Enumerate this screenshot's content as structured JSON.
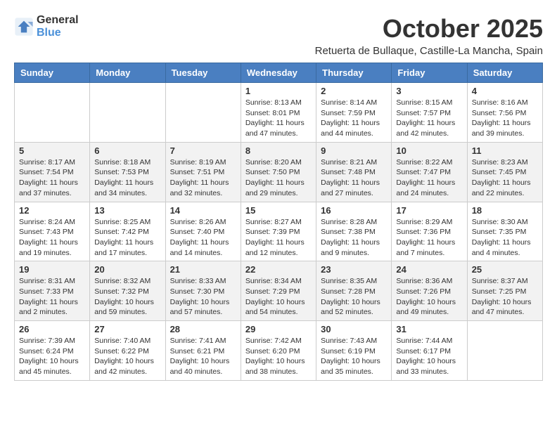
{
  "logo": {
    "general": "General",
    "blue": "Blue"
  },
  "title": "October 2025",
  "location": "Retuerta de Bullaque, Castille-La Mancha, Spain",
  "weekdays": [
    "Sunday",
    "Monday",
    "Tuesday",
    "Wednesday",
    "Thursday",
    "Friday",
    "Saturday"
  ],
  "weeks": [
    [
      {
        "day": "",
        "text": ""
      },
      {
        "day": "",
        "text": ""
      },
      {
        "day": "",
        "text": ""
      },
      {
        "day": "1",
        "text": "Sunrise: 8:13 AM\nSunset: 8:01 PM\nDaylight: 11 hours and 47 minutes."
      },
      {
        "day": "2",
        "text": "Sunrise: 8:14 AM\nSunset: 7:59 PM\nDaylight: 11 hours and 44 minutes."
      },
      {
        "day": "3",
        "text": "Sunrise: 8:15 AM\nSunset: 7:57 PM\nDaylight: 11 hours and 42 minutes."
      },
      {
        "day": "4",
        "text": "Sunrise: 8:16 AM\nSunset: 7:56 PM\nDaylight: 11 hours and 39 minutes."
      }
    ],
    [
      {
        "day": "5",
        "text": "Sunrise: 8:17 AM\nSunset: 7:54 PM\nDaylight: 11 hours and 37 minutes."
      },
      {
        "day": "6",
        "text": "Sunrise: 8:18 AM\nSunset: 7:53 PM\nDaylight: 11 hours and 34 minutes."
      },
      {
        "day": "7",
        "text": "Sunrise: 8:19 AM\nSunset: 7:51 PM\nDaylight: 11 hours and 32 minutes."
      },
      {
        "day": "8",
        "text": "Sunrise: 8:20 AM\nSunset: 7:50 PM\nDaylight: 11 hours and 29 minutes."
      },
      {
        "day": "9",
        "text": "Sunrise: 8:21 AM\nSunset: 7:48 PM\nDaylight: 11 hours and 27 minutes."
      },
      {
        "day": "10",
        "text": "Sunrise: 8:22 AM\nSunset: 7:47 PM\nDaylight: 11 hours and 24 minutes."
      },
      {
        "day": "11",
        "text": "Sunrise: 8:23 AM\nSunset: 7:45 PM\nDaylight: 11 hours and 22 minutes."
      }
    ],
    [
      {
        "day": "12",
        "text": "Sunrise: 8:24 AM\nSunset: 7:43 PM\nDaylight: 11 hours and 19 minutes."
      },
      {
        "day": "13",
        "text": "Sunrise: 8:25 AM\nSunset: 7:42 PM\nDaylight: 11 hours and 17 minutes."
      },
      {
        "day": "14",
        "text": "Sunrise: 8:26 AM\nSunset: 7:40 PM\nDaylight: 11 hours and 14 minutes."
      },
      {
        "day": "15",
        "text": "Sunrise: 8:27 AM\nSunset: 7:39 PM\nDaylight: 11 hours and 12 minutes."
      },
      {
        "day": "16",
        "text": "Sunrise: 8:28 AM\nSunset: 7:38 PM\nDaylight: 11 hours and 9 minutes."
      },
      {
        "day": "17",
        "text": "Sunrise: 8:29 AM\nSunset: 7:36 PM\nDaylight: 11 hours and 7 minutes."
      },
      {
        "day": "18",
        "text": "Sunrise: 8:30 AM\nSunset: 7:35 PM\nDaylight: 11 hours and 4 minutes."
      }
    ],
    [
      {
        "day": "19",
        "text": "Sunrise: 8:31 AM\nSunset: 7:33 PM\nDaylight: 11 hours and 2 minutes."
      },
      {
        "day": "20",
        "text": "Sunrise: 8:32 AM\nSunset: 7:32 PM\nDaylight: 10 hours and 59 minutes."
      },
      {
        "day": "21",
        "text": "Sunrise: 8:33 AM\nSunset: 7:30 PM\nDaylight: 10 hours and 57 minutes."
      },
      {
        "day": "22",
        "text": "Sunrise: 8:34 AM\nSunset: 7:29 PM\nDaylight: 10 hours and 54 minutes."
      },
      {
        "day": "23",
        "text": "Sunrise: 8:35 AM\nSunset: 7:28 PM\nDaylight: 10 hours and 52 minutes."
      },
      {
        "day": "24",
        "text": "Sunrise: 8:36 AM\nSunset: 7:26 PM\nDaylight: 10 hours and 49 minutes."
      },
      {
        "day": "25",
        "text": "Sunrise: 8:37 AM\nSunset: 7:25 PM\nDaylight: 10 hours and 47 minutes."
      }
    ],
    [
      {
        "day": "26",
        "text": "Sunrise: 7:39 AM\nSunset: 6:24 PM\nDaylight: 10 hours and 45 minutes."
      },
      {
        "day": "27",
        "text": "Sunrise: 7:40 AM\nSunset: 6:22 PM\nDaylight: 10 hours and 42 minutes."
      },
      {
        "day": "28",
        "text": "Sunrise: 7:41 AM\nSunset: 6:21 PM\nDaylight: 10 hours and 40 minutes."
      },
      {
        "day": "29",
        "text": "Sunrise: 7:42 AM\nSunset: 6:20 PM\nDaylight: 10 hours and 38 minutes."
      },
      {
        "day": "30",
        "text": "Sunrise: 7:43 AM\nSunset: 6:19 PM\nDaylight: 10 hours and 35 minutes."
      },
      {
        "day": "31",
        "text": "Sunrise: 7:44 AM\nSunset: 6:17 PM\nDaylight: 10 hours and 33 minutes."
      },
      {
        "day": "",
        "text": ""
      }
    ]
  ]
}
